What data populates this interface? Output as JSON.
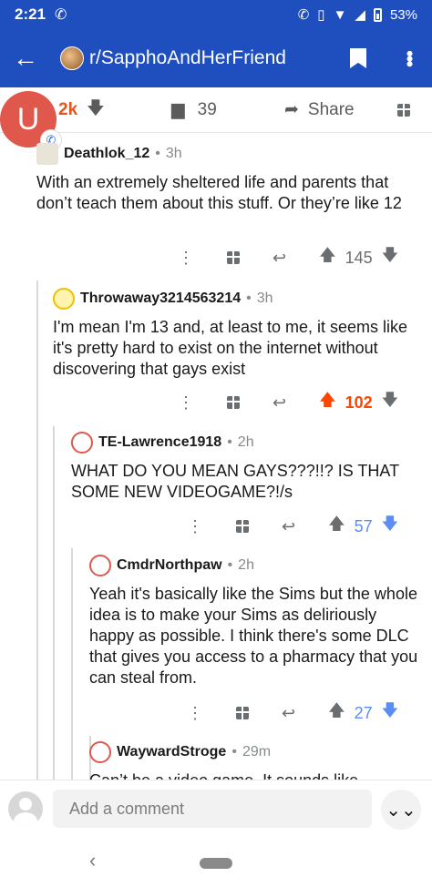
{
  "status_bar": {
    "time": "2:21",
    "battery": "53%"
  },
  "app_bar": {
    "subreddit": "r/SapphoAndHerFriend"
  },
  "post_bar": {
    "votes": "2k",
    "comments": "39",
    "share": "Share"
  },
  "overlay": {
    "letter": "U"
  },
  "comments": [
    {
      "user": "Deathlok_12",
      "age": "3h",
      "body": "With an extremely sheltered life and parents that don’t teach them about this stuff. Or they’re like 12",
      "score": "145",
      "vote_state": "none"
    },
    {
      "user": "Throwaway3214563214",
      "age": "3h",
      "body": "I'm mean I'm 13 and, at least to me, it seems like it's pretty hard to exist on the internet without discovering that gays exist",
      "score": "102",
      "vote_state": "up"
    },
    {
      "user": "TE-Lawrence1918",
      "age": "2h",
      "body": "WHAT DO YOU MEAN GAYS???!!? IS THAT SOME NEW VIDEOGAME?!/s",
      "score": "57",
      "vote_state": "down"
    },
    {
      "user": "CmdrNorthpaw",
      "age": "2h",
      "body": "Yeah it's basically like the Sims but the whole idea is to make your Sims as deliriously happy as possible. I think there's some DLC that gives you access to a pharmacy that you can steal from.",
      "score": "27",
      "vote_state": "down"
    },
    {
      "user": "WaywardStroge",
      "age": "29m",
      "body": "Can’t be a video game. It sounds like"
    }
  ],
  "composer": {
    "placeholder": "Add a comment"
  },
  "colors": {
    "brand_blue": "#1f4fbf",
    "upvote": "#ff4500",
    "downvote": "#5b8ef0"
  }
}
